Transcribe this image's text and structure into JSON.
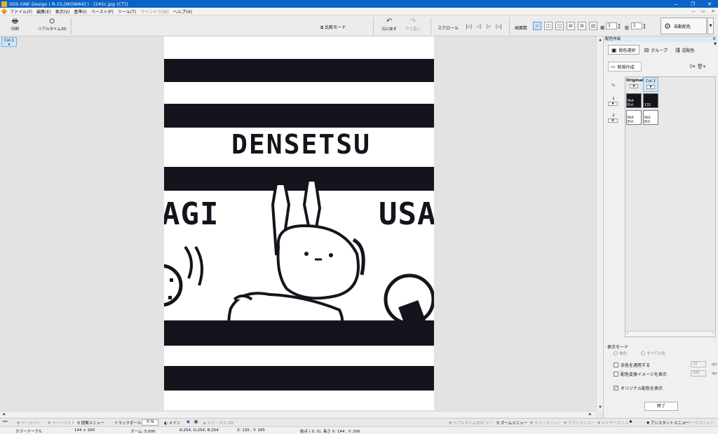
{
  "window": {
    "title": "SDS-ONE Design ( R-15,[WOW64] ) - [245c.jpg (CT)]",
    "controls": [
      "—",
      "❐",
      "✕"
    ]
  },
  "menu": {
    "items": [
      "ファイル(F)",
      "編集(E)",
      "表示(V)",
      "基準(I)",
      "ペースト(P)",
      "ツール(T)",
      "ウインドウ(W)",
      "ヘルプ(H)"
    ],
    "disabled_index": 6,
    "mdi_controls": [
      "—",
      "▭",
      "✕"
    ]
  },
  "toolbar": {
    "print": "印刷",
    "realtime3d": "リアルタイム3D",
    "compare_mode": "比較モード",
    "undo": "元に戻す",
    "redo": "やり直し",
    "scroll": "スクロール",
    "screen_count": "画面数",
    "horizontal": "横",
    "horizontal_value": "1",
    "vertical": "縦",
    "vertical_value": "1",
    "auto_coloring": "自動配色"
  },
  "canvas": {
    "col_tab": "Col.1",
    "image_text_top": "DENSETSU",
    "image_text_left": "AGI",
    "image_text_right": "USA"
  },
  "panel": {
    "header": "配色作成",
    "tabs": [
      "配色選択",
      "グループ",
      "送配色"
    ],
    "new_button": "新規作成",
    "columns": [
      "Original",
      "Col.1"
    ],
    "rows": [
      {
        "label": "1",
        "swatches": [
          {
            "text": "Not Ent",
            "color": "#14141c"
          },
          {
            "text": "131",
            "color": "#14141c"
          }
        ]
      },
      {
        "label": "2",
        "swatches": [
          {
            "text": "Not Ent",
            "color": "#ffffff"
          },
          {
            "text": "Not Ent",
            "color": "#ffffff"
          }
        ]
      }
    ],
    "display_mode_label": "表示モード",
    "radio_single": "単色",
    "radio_all": "すべての色",
    "chk_residual": "余色を適用する",
    "chk_coloring_image": "配色変換イメージを表示",
    "chk_original": "オリジナル配色を表示",
    "field1": "72",
    "field2": "100",
    "unit": "dpi",
    "end_button": "終了"
  },
  "bottombar": {
    "toolbar_lbl": "ツールバー",
    "palette_lbl": "ページラスト",
    "menu_lbl": "提案メニュー",
    "trackball": "トラックボール",
    "on": "O N",
    "main": "メイン",
    "status_on": "ステータス ON",
    "realtime_view": "リアルタイム3Dビュー",
    "zoom_menu": "ズームメニュー",
    "color_menu": "カラーメニュー",
    "brush_menu": "ブラシメニュー",
    "layer_menu": "レイヤーメニュー",
    "assistant": "アシスタントメニュー",
    "work_menu": "ワークメニュー"
  },
  "status": {
    "mode": "カラーテーブル",
    "size": "144 × 200",
    "zoom": "ズーム: 5.000",
    "rgb": "R:254, G:254, B:254",
    "xy": "X:  135 ,  Y:  165",
    "start": "始点 (    0,     0),  長さ X:  144 ,  Y:  200"
  },
  "colors": {
    "title_bar": "#0a63c7",
    "image_dark": "#14141c",
    "selected": "#cfe4fa"
  }
}
